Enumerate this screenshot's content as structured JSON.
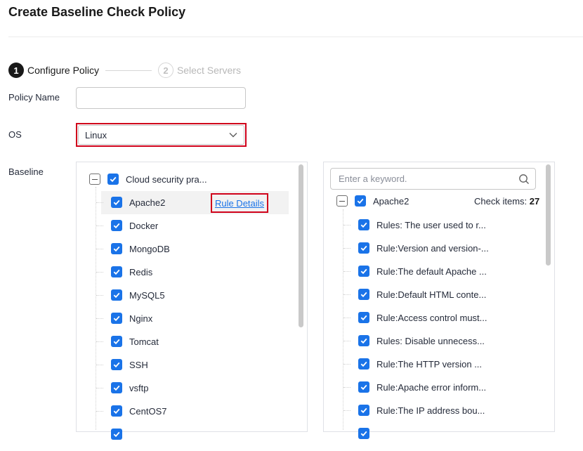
{
  "page": {
    "title": "Create Baseline Check Policy"
  },
  "steps": [
    {
      "number": "1",
      "label": "Configure Policy",
      "state": "active"
    },
    {
      "number": "2",
      "label": "Select Servers",
      "state": "inactive"
    }
  ],
  "form": {
    "policy_name_label": "Policy Name",
    "policy_name_value": "",
    "os_label": "OS",
    "os_value": "Linux",
    "baseline_label": "Baseline"
  },
  "baseline_tree": {
    "root_label": "Cloud security pra...",
    "items": [
      {
        "label": "Apache2",
        "checked": true
      },
      {
        "label": "Docker",
        "checked": true
      },
      {
        "label": "MongoDB",
        "checked": true
      },
      {
        "label": "Redis",
        "checked": true
      },
      {
        "label": "MySQL5",
        "checked": true
      },
      {
        "label": "Nginx",
        "checked": true
      },
      {
        "label": "Tomcat",
        "checked": true
      },
      {
        "label": "SSH",
        "checked": true
      },
      {
        "label": "vsftp",
        "checked": true
      },
      {
        "label": "CentOS7",
        "checked": true
      }
    ],
    "rule_details_label": "Rule Details"
  },
  "rules_panel": {
    "search_placeholder": "Enter a keyword.",
    "group_label": "Apache2",
    "check_items_label": "Check items:",
    "check_items_count": "27",
    "rules": [
      "Rules: The user used to r...",
      "Rule:Version and version-...",
      "Rule:The default Apache ...",
      "Rule:Default HTML conte...",
      "Rule:Access control must...",
      "Rules: Disable unnecess...",
      "Rule:The HTTP version ...",
      "Rule:Apache error inform...",
      "Rule:The IP address bou..."
    ]
  },
  "colors": {
    "accent": "#1a73e8",
    "highlight_border": "#d0021b",
    "text": "#252b3a"
  },
  "icons": {
    "os_select": "chevron-down-icon",
    "search": "search-icon",
    "checkbox": "check-icon",
    "tree_toggle": "collapse-icon"
  }
}
